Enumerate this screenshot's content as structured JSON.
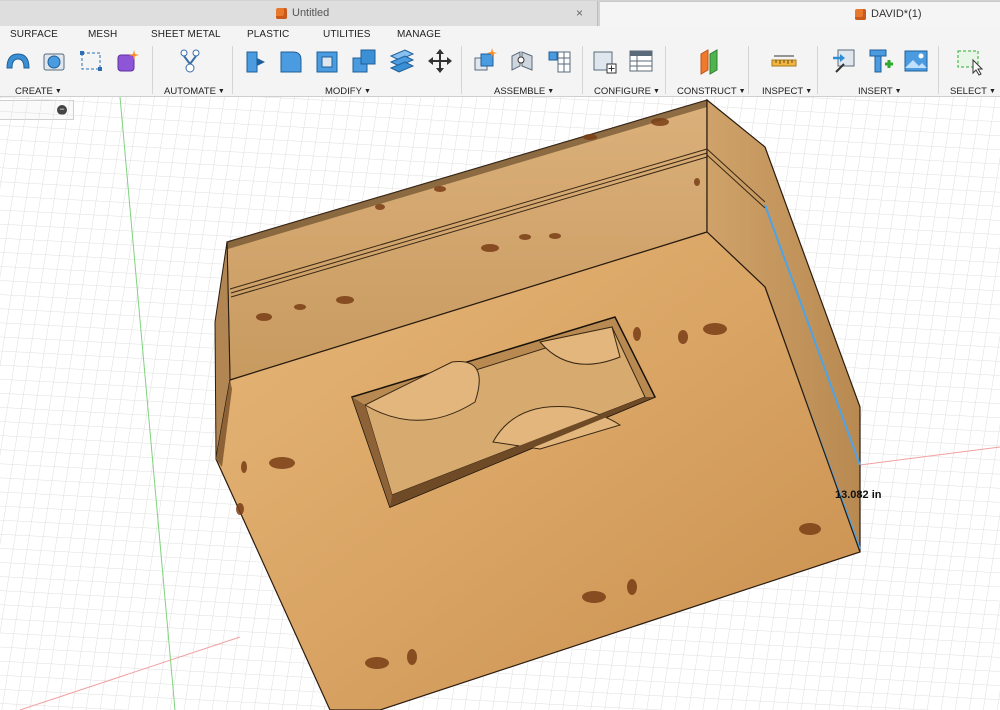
{
  "tabs": {
    "untitled": "Untitled",
    "active": "DAVID*(1)",
    "close_glyph": "×"
  },
  "toolbar": {
    "tabs": [
      "SURFACE",
      "MESH",
      "SHEET METAL",
      "PLASTIC",
      "UTILITIES",
      "MANAGE"
    ],
    "groups": {
      "create": "CREATE",
      "automate": "AUTOMATE",
      "modify": "MODIFY",
      "assemble": "ASSEMBLE",
      "configure": "CONFIGURE",
      "construct": "CONSTRUCT",
      "inspect": "INSPECT",
      "insert": "INSERT",
      "select": "SELECT"
    },
    "dropdown_glyph": "▼",
    "accent": "#2c8ed6",
    "select_accent": "#2eaa2e"
  },
  "panel": {
    "collapse_glyph": "−"
  },
  "viewport": {
    "dimension": "13.082 in",
    "model": "wooden box",
    "grid_color": "#d8d8d8",
    "wood_color": "#d9a868"
  }
}
